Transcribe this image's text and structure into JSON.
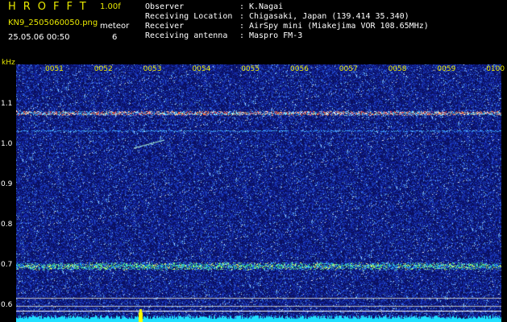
{
  "header": {
    "title": "HROFFT",
    "version": "1.00f",
    "filename": "KN9_2505060050.png",
    "meteor_label": "meteor",
    "datetime": "25.05.06 00:50",
    "meteor_count": "6"
  },
  "info": [
    {
      "label": "Observer",
      "value": "K.Nagai"
    },
    {
      "label": "Receiving Location",
      "value": "Chigasaki, Japan (139.414 35.340)"
    },
    {
      "label": "Receiver",
      "value": "AirSpy mini (Miakejima VOR 108.65MHz)"
    },
    {
      "label": "Receiving antenna",
      "value": "Maspro FM-3"
    }
  ],
  "axis": {
    "unit": "kHz",
    "y_ticks": [
      "1.1",
      "1.0",
      "0.9",
      "0.8",
      "0.7",
      "0.6"
    ],
    "time_ticks": [
      "0051",
      "0052",
      "0053",
      "0054",
      "0055",
      "0056",
      "0057",
      "0058",
      "0059",
      "0100"
    ]
  },
  "colors": {
    "label_yellow": "#e8e800",
    "text_white": "#ffffff",
    "background": "#000000",
    "noise_blue": "#1a2a9a",
    "carrier_red": "#ff5050",
    "band_green": "#40e080",
    "baseline_cyan": "#20e0ff"
  }
}
